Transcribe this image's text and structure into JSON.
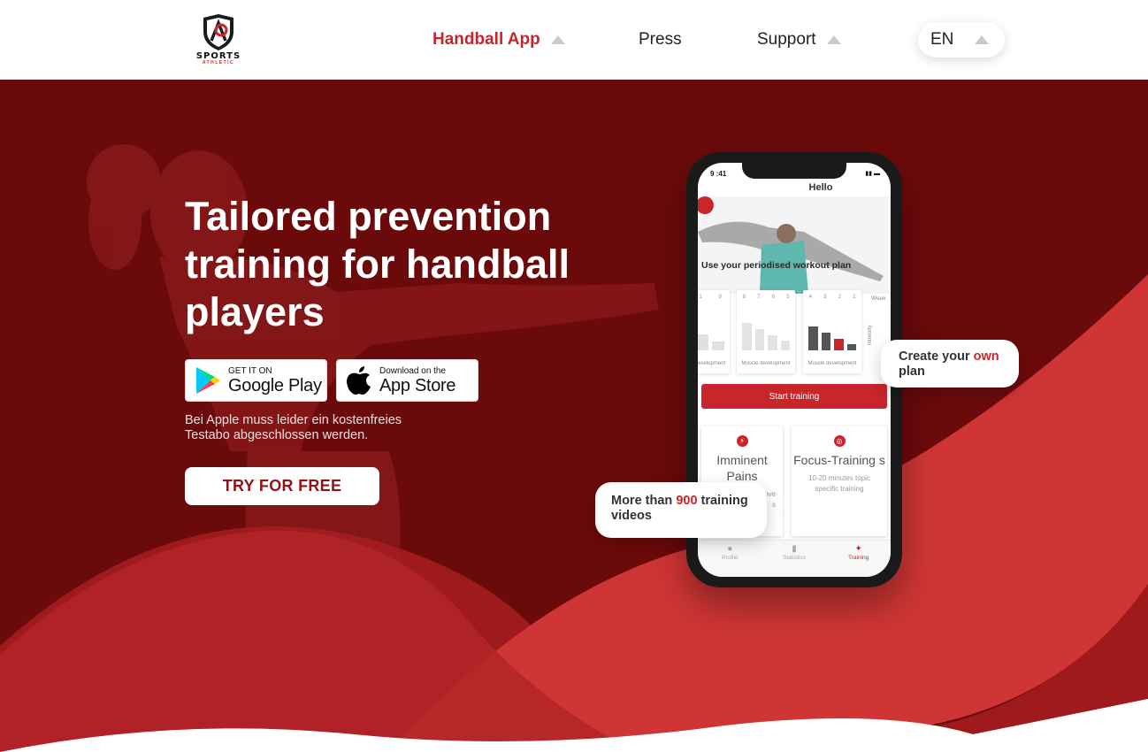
{
  "header": {
    "logo": {
      "name": "SPORTS",
      "sub": "ATHLETIC"
    },
    "nav": [
      {
        "label": "Handball App",
        "active": true,
        "has_dropdown": true
      },
      {
        "label": "Press",
        "active": false,
        "has_dropdown": false
      },
      {
        "label": "Support",
        "active": false,
        "has_dropdown": true
      }
    ],
    "language": "EN"
  },
  "hero": {
    "headline": "Tailored prevention training for handball players",
    "google_play": {
      "small": "GET IT ON",
      "big": "Google Play"
    },
    "app_store": {
      "small": "Download on the",
      "big": "App Store"
    },
    "note": "Bei Apple muss leider ein kostenfreies Testabo abgeschlossen werden.",
    "cta": "TRY FOR FREE"
  },
  "phone": {
    "time": "9 :41",
    "greeting": "Hello",
    "workout_title": "Use your periodised workout plan",
    "week_label": "Week",
    "intensity_label": "Intensity",
    "cards": [
      {
        "weeks": [
          "1",
          "9"
        ],
        "label": "development"
      },
      {
        "weeks": [
          "8",
          "7",
          "6",
          "5"
        ],
        "label": "Muscle development"
      },
      {
        "weeks": [
          "4",
          "3",
          "2",
          "1"
        ],
        "label": "Muscle development"
      }
    ],
    "start_button": "Start training",
    "tiles": [
      {
        "title": "Imminent Pains",
        "desc": "ove\ns"
      },
      {
        "title": "Focus-Training s",
        "desc": "10-20 minutes topic specific training"
      }
    ],
    "tabs": [
      "Profile",
      "Statistics",
      "Training"
    ]
  },
  "bubbles": {
    "plan": {
      "pre": "Create your ",
      "highlight": "own",
      "post": " plan"
    },
    "videos": {
      "pre": "More than ",
      "highlight": "900",
      "post": " training videos"
    }
  },
  "colors": {
    "brand_red": "#c8262a",
    "dark_red": "#6b0a0b",
    "accent_text": "#c1272d"
  }
}
